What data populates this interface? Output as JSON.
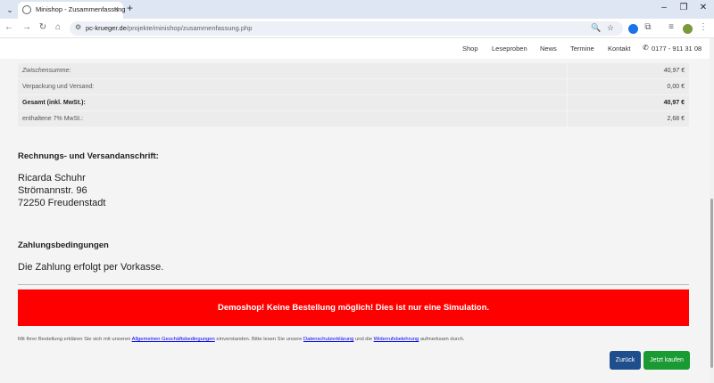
{
  "browser": {
    "tab_title": "Minishop - Zusammenfassung",
    "tab_close": "×",
    "new_tab": "+",
    "url_domain": "pc-krueger.de",
    "url_path": "/projekte/minishop/zusammenfassung.php",
    "window_controls": [
      "–",
      "❐",
      "✕"
    ]
  },
  "nav": {
    "items": [
      "Shop",
      "Leseproben",
      "News",
      "Termine",
      "Kontakt"
    ],
    "phone": "0177 - 911 31 08"
  },
  "summary": [
    {
      "label": "Zwischensumme:",
      "value": "40,97 €",
      "style": "italic"
    },
    {
      "label": "Verpackung und Versand:",
      "value": "0,00 €",
      "style": "normal"
    },
    {
      "label": "Gesamt (inkl. MwSt.):",
      "value": "40,97 €",
      "style": "bold"
    },
    {
      "label": "enthaltene 7% MwSt.:",
      "value": "2,68 €",
      "style": "normal"
    }
  ],
  "address": {
    "heading": "Rechnungs- und Versandanschrift:",
    "name": "Ricarda Schuhr",
    "street": "Strömannstr. 96",
    "city": "72250 Freudenstadt"
  },
  "payment": {
    "heading": "Zahlungsbedingungen",
    "text": "Die Zahlung erfolgt per Vorkasse."
  },
  "banner": "Demoshop! Keine Bestellung möglich! Dies ist nur eine Simulation.",
  "terms": {
    "part1": "Mit Ihrer Bestellung erklären Sie sich mit unseren ",
    "link_agb": "Allgemeinen Geschäftsbedingungen",
    "part2": " einverstanden. Bitte lesen Sie unsere ",
    "link_privacy": "Datenschutzerklärung",
    "part3": " und die ",
    "link_withdrawal": "Widerrufsbelehrung",
    "part4": " aufmerksam durch."
  },
  "buttons": {
    "back": "Zurück",
    "buy": "Jetzt kaufen"
  },
  "colors": {
    "banner": "#ff0000",
    "buy_button": "#1a9a33",
    "back_button": "#1f4e8c"
  }
}
